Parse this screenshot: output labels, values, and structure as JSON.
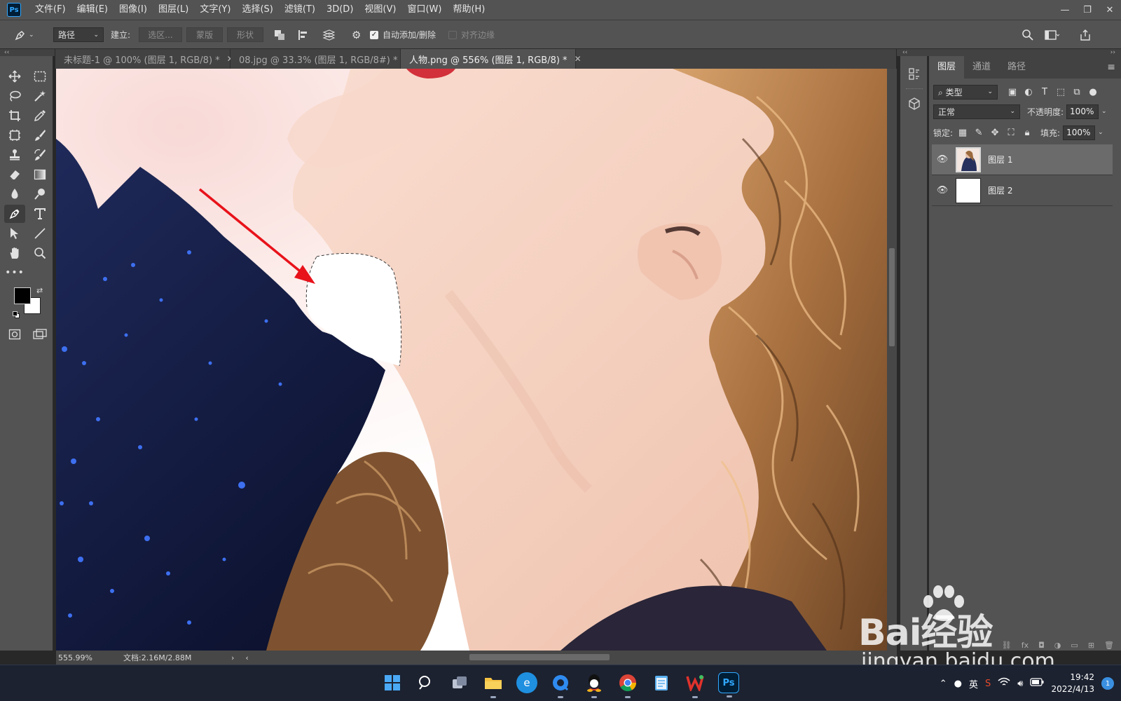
{
  "app": {
    "logo": "Ps",
    "menu": [
      "文件(F)",
      "编辑(E)",
      "图像(I)",
      "图层(L)",
      "文字(Y)",
      "选择(S)",
      "滤镜(T)",
      "3D(D)",
      "视图(V)",
      "窗口(W)",
      "帮助(H)"
    ],
    "window_controls": [
      "minimize-icon",
      "restore-icon",
      "close-icon"
    ]
  },
  "options": {
    "tool_mode": "路径",
    "make_label": "建立:",
    "selection_btn": "选区...",
    "mask_btn": "蒙版",
    "shape_btn": "形状",
    "auto_add_delete": "自动添加/删除",
    "auto_add_delete_checked": true,
    "align_edges": "对齐边缘",
    "align_edges_checked": false
  },
  "tabs": [
    {
      "label": "未标题-1 @ 100% (图层 1, RGB/8) *",
      "active": false
    },
    {
      "label": "08.jpg @ 33.3% (图层 1, RGB/8#) *",
      "active": false
    },
    {
      "label": "人物.png @ 556% (图层 1, RGB/8) *",
      "active": true
    }
  ],
  "tools": [
    "move-tool",
    "marquee-tool",
    "lasso-tool",
    "magic-wand-tool",
    "crop-tool",
    "eyedropper-tool",
    "frame-tool",
    "brush-tool",
    "stamp-tool",
    "history-brush-tool",
    "eraser-tool",
    "gradient-tool",
    "blur-tool",
    "dodge-tool",
    "pen-tool",
    "type-tool",
    "path-select-tool",
    "line-tool",
    "hand-tool",
    "zoom-tool",
    "more-tools"
  ],
  "colors": {
    "foreground": "#000000",
    "background": "#ffffff",
    "arrow": "#e8121a"
  },
  "status": {
    "zoom": "555.99%",
    "doc": "文档:2.16M/2.88M"
  },
  "layers_panel": {
    "tabs": [
      "图层",
      "通道",
      "路径"
    ],
    "filter": "类型",
    "blend_mode": "正常",
    "opacity_label": "不透明度:",
    "opacity": "100%",
    "lock_label": "锁定:",
    "fill_label": "填充:",
    "fill": "100%",
    "layers": [
      {
        "name": "图层 1",
        "selected": true
      },
      {
        "name": "图层 2",
        "selected": false
      }
    ]
  },
  "watermark": {
    "logo": "Bai经验",
    "url": "jingyan.baidu.com"
  },
  "taskbar": {
    "input_method": "英",
    "time": "19:42",
    "date": "2022/4/13",
    "notifications": "1"
  }
}
